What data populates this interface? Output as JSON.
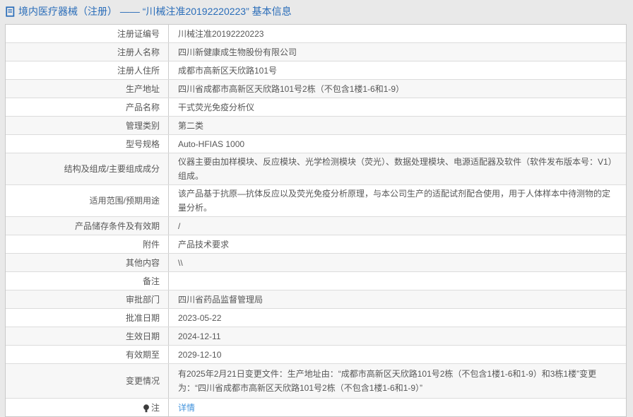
{
  "colors": {
    "page_bg": "#e9e9e9",
    "table_bg": "#ffffff",
    "alt_row_bg": "#f7f7f7",
    "outer_border": "#c9c9c9",
    "row_border": "#dcdcdc",
    "title_blue": "#2a6db9",
    "link_blue": "#4293dc",
    "text": "#575757"
  },
  "header": {
    "icon": "document-icon",
    "title": "境内医疗器械（注册） —— “川械注准20192220223” 基本信息"
  },
  "table": {
    "rows": [
      {
        "label": "注册证编号",
        "value": "川械注准20192220223"
      },
      {
        "label": "注册人名称",
        "value": "四川新健康成生物股份有限公司"
      },
      {
        "label": "注册人住所",
        "value": "成都市高新区天欣路101号"
      },
      {
        "label": "生产地址",
        "value": "四川省成都市高新区天欣路101号2栋（不包含1楼1-6和1-9）"
      },
      {
        "label": "产品名称",
        "value": "干式荧光免疫分析仪"
      },
      {
        "label": "管理类别",
        "value": "第二类"
      },
      {
        "label": "型号规格",
        "value": "Auto-HFIAS 1000"
      },
      {
        "label": "结构及组成/主要组成成分",
        "value": "仪器主要由加样模块、反应模块、光学检测模块（荧光）、数据处理模块、电源适配器及软件（软件发布版本号：V1）组成。"
      },
      {
        "label": "适用范围/预期用途",
        "value": "该产品基于抗原—抗体反应以及荧光免疫分析原理，与本公司生产的适配试剂配合使用，用于人体样本中待测物的定量分析。"
      },
      {
        "label": "产品储存条件及有效期",
        "value": "/"
      },
      {
        "label": "附件",
        "value": "产品技术要求"
      },
      {
        "label": "其他内容",
        "value": "\\\\"
      },
      {
        "label": "备注",
        "value": ""
      },
      {
        "label": "审批部门",
        "value": "四川省药品监督管理局"
      },
      {
        "label": "批准日期",
        "value": "2023-05-22"
      },
      {
        "label": "生效日期",
        "value": "2024-12-11"
      },
      {
        "label": "有效期至",
        "value": "2029-12-10"
      },
      {
        "label": "变更情况",
        "value": "有2025年2月21日变更文件：生产地址由：“成都市高新区天欣路101号2栋（不包含1楼1-6和1-9）和3栋1楼”变更为：“四川省成都市高新区天欣路101号2栋（不包含1楼1-6和1-9）”",
        "tall": true
      },
      {
        "label": "注",
        "label_icon": "note-icon",
        "value": "详情",
        "link": true
      }
    ]
  }
}
